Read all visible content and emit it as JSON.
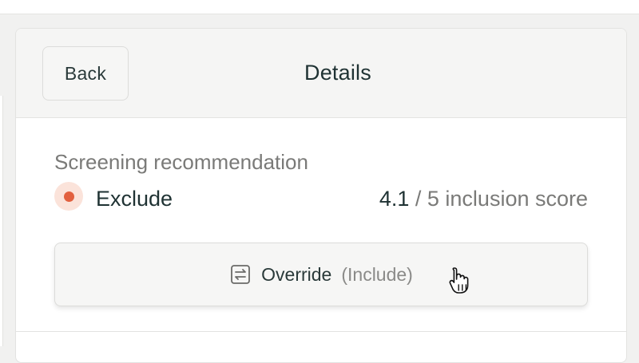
{
  "header": {
    "back_label": "Back",
    "title": "Details"
  },
  "screening": {
    "label": "Screening recommendation",
    "decision": "Exclude",
    "decision_color": "#e2603f",
    "score_value": "4.1",
    "score_suffix": "/ 5 inclusion score"
  },
  "override": {
    "label": "Override",
    "sub_label": "(Include)",
    "icon": "swap-arrows-icon"
  },
  "cursor": {
    "icon": "hand-pointer-cursor-icon"
  }
}
